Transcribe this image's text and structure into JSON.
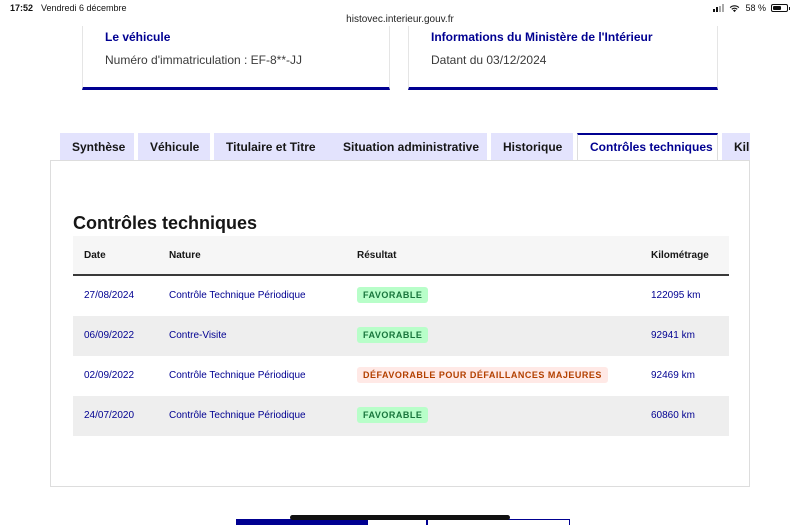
{
  "status_bar": {
    "time": "17:52",
    "date": "Vendredi 6 décembre",
    "battery": "58 %"
  },
  "browser": {
    "url": "histovec.interieur.gouv.fr"
  },
  "cards": {
    "vehicle": {
      "title": "Le véhicule",
      "text": "Numéro d'immatriculation : EF-8**-JJ"
    },
    "ministry": {
      "title": "Informations du Ministère de l'Intérieur",
      "text": "Datant du 03/12/2024"
    }
  },
  "tabs": [
    {
      "label": "Synthèse",
      "active": false
    },
    {
      "label": "Véhicule",
      "active": false
    },
    {
      "label": "Titulaire et Titre",
      "active": false
    },
    {
      "label": "Situation administrative",
      "active": false
    },
    {
      "label": "Historique",
      "active": false
    },
    {
      "label": "Contrôles techniques",
      "active": true
    },
    {
      "label": "Kil",
      "active": false
    }
  ],
  "panel": {
    "title": "Contrôles techniques",
    "columns": {
      "date": "Date",
      "nature": "Nature",
      "result": "Résultat",
      "km": "Kilométrage"
    },
    "rows": [
      {
        "date": "27/08/2024",
        "nature": "Contrôle Technique Périodique",
        "result": "FAVORABLE",
        "status": "ok",
        "km": "122095 km"
      },
      {
        "date": "06/09/2022",
        "nature": "Contre-Visite",
        "result": "FAVORABLE",
        "status": "ok",
        "km": "92941 km"
      },
      {
        "date": "02/09/2022",
        "nature": "Contrôle Technique Périodique",
        "result": "DÉFAVORABLE POUR DÉFAILLANCES MAJEURES",
        "status": "ko",
        "km": "92469 km"
      },
      {
        "date": "24/07/2020",
        "nature": "Contrôle Technique Périodique",
        "result": "FAVORABLE",
        "status": "ok",
        "km": "60860 km"
      }
    ]
  },
  "colors": {
    "primary": "#000091",
    "tab_bg": "#e3e3fd",
    "success_bg": "#b8fec9",
    "success_text": "#18753c",
    "error_bg": "#ffe9e6",
    "error_text": "#b34000"
  }
}
